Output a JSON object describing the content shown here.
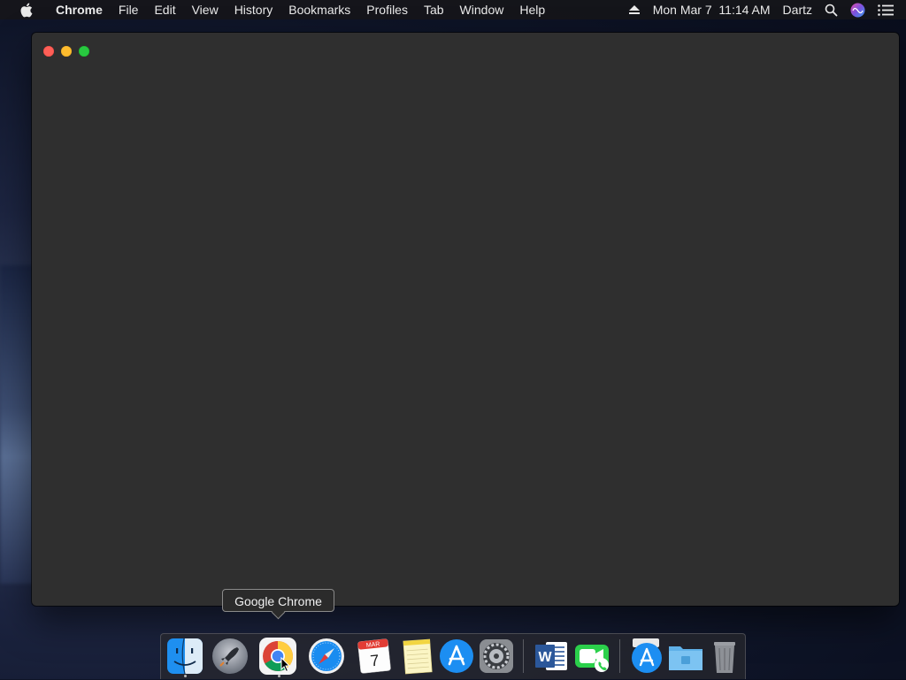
{
  "menubar": {
    "app_name": "Chrome",
    "menus": [
      "File",
      "Edit",
      "View",
      "History",
      "Bookmarks",
      "Profiles",
      "Tab",
      "Window",
      "Help"
    ],
    "clock": "Mon Mar 7  11:14 AM",
    "user": "Dartz"
  },
  "window": {
    "title": "",
    "background": "#2f2f2f"
  },
  "tooltip": {
    "text": "Google Chrome"
  },
  "dock": {
    "apps": [
      {
        "name": "Finder",
        "icon": "finder-icon",
        "running": true
      },
      {
        "name": "Launchpad",
        "icon": "launchpad-icon",
        "running": false
      },
      {
        "name": "Google Chrome",
        "icon": "chrome-icon",
        "running": true
      },
      {
        "name": "Safari",
        "icon": "safari-icon",
        "running": false
      },
      {
        "name": "Calendar",
        "icon": "calendar-icon",
        "running": false,
        "month": "MAR",
        "day": "7"
      },
      {
        "name": "Notes",
        "icon": "notes-icon",
        "running": false
      },
      {
        "name": "App Store",
        "icon": "app-store-icon",
        "running": false
      },
      {
        "name": "System Preferences",
        "icon": "system-preferences-icon",
        "running": false
      },
      {
        "name": "Microsoft Word",
        "icon": "word-icon",
        "running": false
      },
      {
        "name": "FaceTime",
        "icon": "facetime-icon",
        "running": false
      },
      {
        "name": "Downloads Stack",
        "icon": "downloads-stack-icon",
        "running": false
      },
      {
        "name": "Folder",
        "icon": "folder-icon",
        "running": false
      },
      {
        "name": "Trash",
        "icon": "trash-icon",
        "running": false
      }
    ]
  },
  "colors": {
    "close": "#ff5f57",
    "minimize": "#febc2e",
    "maximize": "#28c840"
  }
}
